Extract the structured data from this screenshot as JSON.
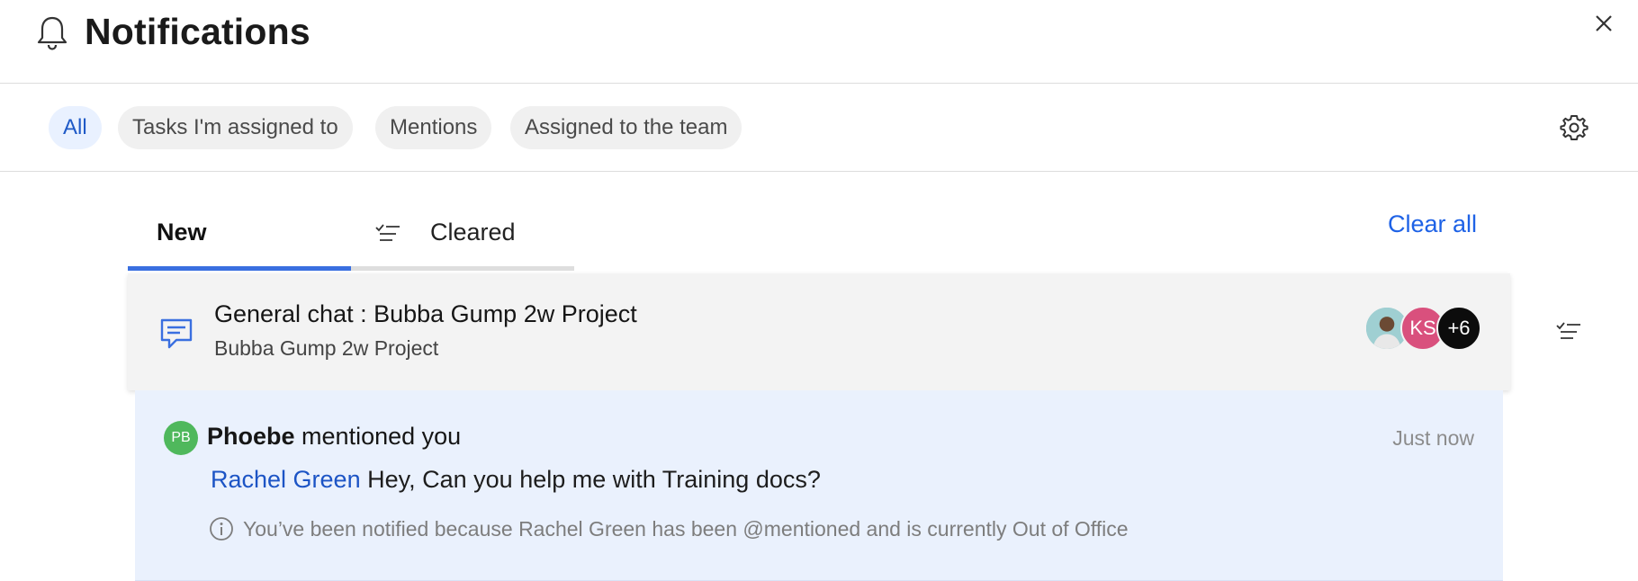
{
  "header": {
    "title": "Notifications",
    "icon": "bell-icon",
    "close_icon": "close-icon"
  },
  "filters": {
    "chips": [
      {
        "label": "All",
        "active": true
      },
      {
        "label": "Tasks I'm assigned to",
        "active": false
      },
      {
        "label": "Mentions",
        "active": false
      },
      {
        "label": "Assigned to the team",
        "active": false
      }
    ],
    "settings_icon": "gear-icon"
  },
  "tabs": {
    "items": [
      {
        "label": "New",
        "active": true
      },
      {
        "label": "Cleared",
        "active": false,
        "icon": "clear-list-icon"
      }
    ],
    "clear_all": "Clear all"
  },
  "group": {
    "title": "General chat : Bubba Gump 2w Project",
    "subtitle": "Bubba Gump 2w Project",
    "icon": "chat-icon",
    "avatars": [
      {
        "type": "photo"
      },
      {
        "initials": "KS"
      },
      {
        "more": "+6"
      }
    ]
  },
  "notification": {
    "avatar_initials": "PB",
    "actor": "Phoebe",
    "action": "mentioned you",
    "time": "Just now",
    "mention_name": "Rachel Green",
    "message": "Hey, Can you help me with Training docs?",
    "info": "You’ve been notified because Rachel Green has been @mentioned and is currently Out of Office"
  },
  "colors": {
    "accent": "#1e62e6",
    "active_chip_bg": "#e9f1ff",
    "message_bg": "#eaf1fd",
    "group_bg": "#f3f3f3"
  }
}
